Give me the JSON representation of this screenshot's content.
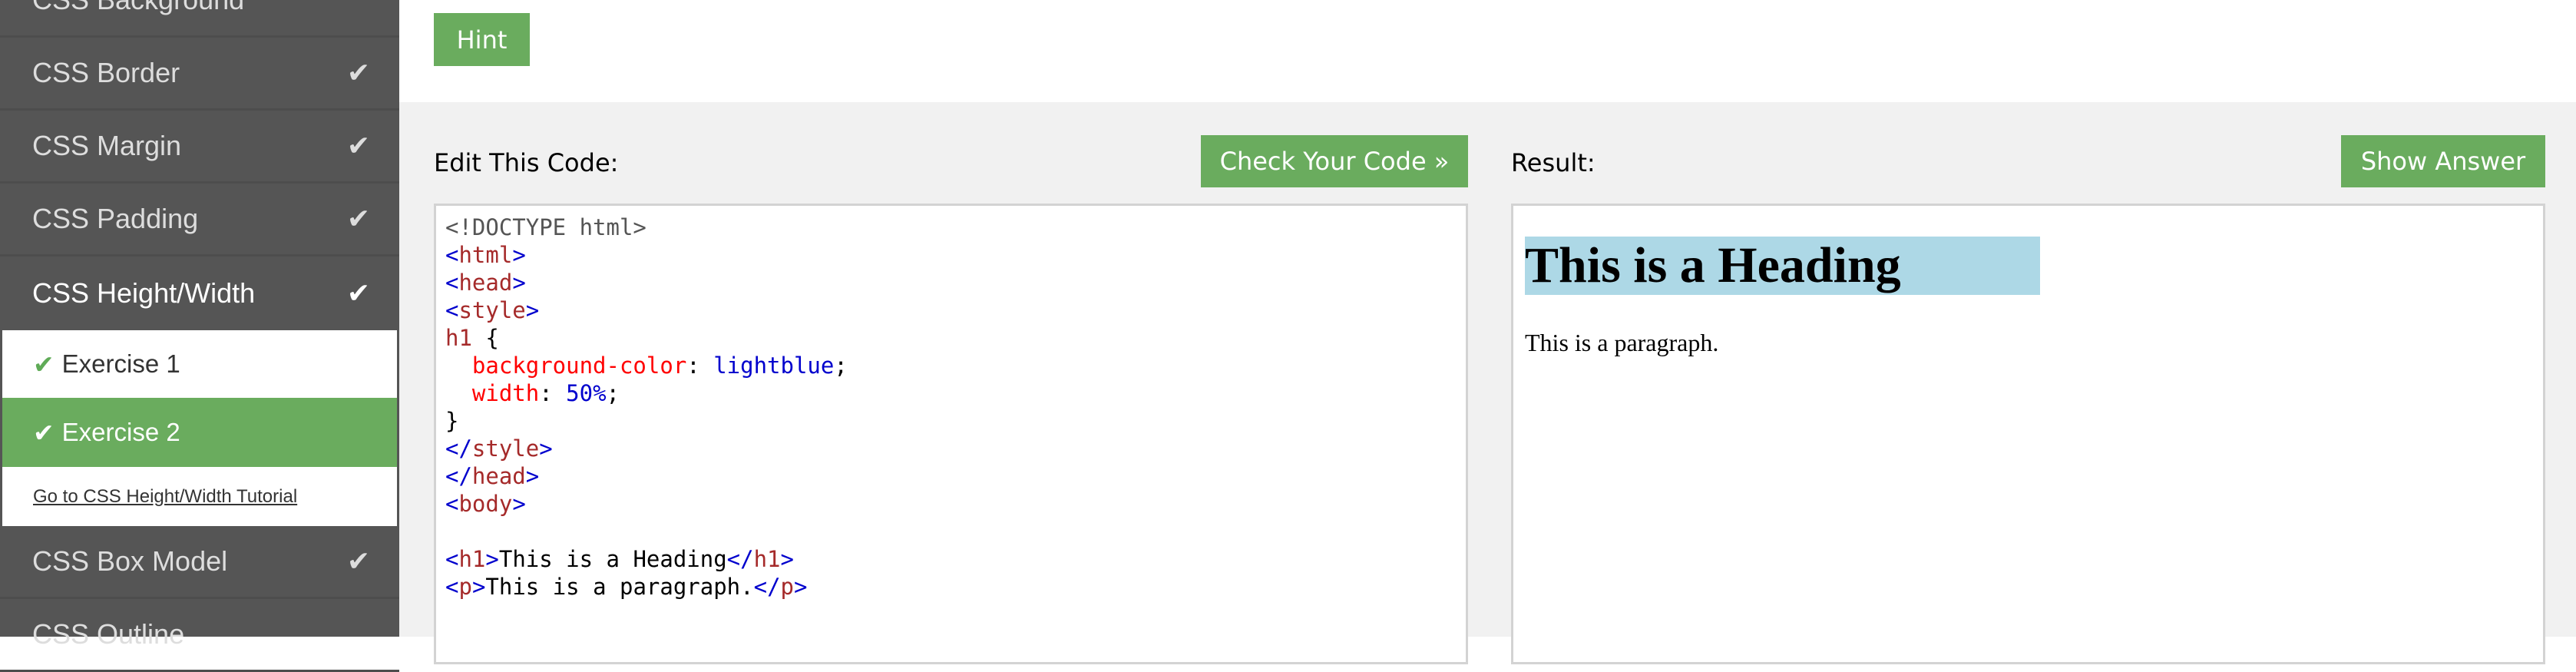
{
  "sidebar": {
    "items": [
      {
        "label": "CSS Background"
      },
      {
        "label": "CSS Border",
        "done": true
      },
      {
        "label": "CSS Margin",
        "done": true
      },
      {
        "label": "CSS Padding",
        "done": true
      },
      {
        "label": "CSS Height/Width",
        "done": true
      },
      {
        "label": "CSS Box Model",
        "done": true
      },
      {
        "label": "CSS Outline"
      }
    ],
    "exercises": [
      {
        "label": "Exercise 1"
      },
      {
        "label": "Exercise 2"
      }
    ],
    "tutorial_link": "Go to CSS Height/Width Tutorial",
    "check_icon": "✔"
  },
  "toolbar": {
    "hint": "Hint",
    "check": "Check Your Code »",
    "show_answer": "Show Answer"
  },
  "editor": {
    "label": "Edit This Code:"
  },
  "result": {
    "label": "Result:",
    "heading": "This is a Heading",
    "paragraph": "This is a paragraph."
  },
  "colors": {
    "green": "#6aac5e",
    "sidebar": "#555555",
    "heading_bg": "#add8e6"
  }
}
